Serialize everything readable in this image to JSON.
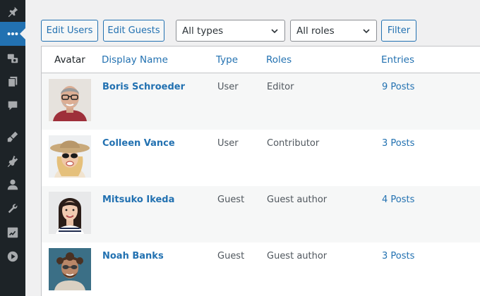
{
  "sidebar": {
    "items": [
      {
        "icon": "pin-icon"
      },
      {
        "icon": "more-icon",
        "active": true
      },
      {
        "icon": "media-icon"
      },
      {
        "icon": "pages-icon"
      },
      {
        "icon": "comments-icon"
      },
      {
        "icon": "appearance-icon"
      },
      {
        "icon": "plugins-icon"
      },
      {
        "icon": "users-icon"
      },
      {
        "icon": "tools-icon"
      },
      {
        "icon": "settings-icon"
      },
      {
        "icon": "play-icon"
      }
    ]
  },
  "toolbar": {
    "edit_users": "Edit Users",
    "edit_guests": "Edit Guests",
    "type_select": "All types",
    "role_select": "All roles",
    "filter": "Filter"
  },
  "table": {
    "headers": {
      "avatar": "Avatar",
      "display_name": "Display Name",
      "type": "Type",
      "roles": "Roles",
      "entries": "Entries"
    },
    "rows": [
      {
        "name": "Boris Schroeder",
        "type": "User",
        "role": "Editor",
        "entries": "9 Posts"
      },
      {
        "name": "Colleen Vance",
        "type": "User",
        "role": "Contributor",
        "entries": "3 Posts"
      },
      {
        "name": "Mitsuko Ikeda",
        "type": "Guest",
        "role": "Guest author",
        "entries": "4 Posts"
      },
      {
        "name": "Noah Banks",
        "type": "Guest",
        "role": "Guest author",
        "entries": "3 Posts"
      }
    ]
  },
  "colors": {
    "accent": "#2271b1",
    "sidebar_bg": "#1d2327",
    "page_bg": "#f0f0f1"
  }
}
